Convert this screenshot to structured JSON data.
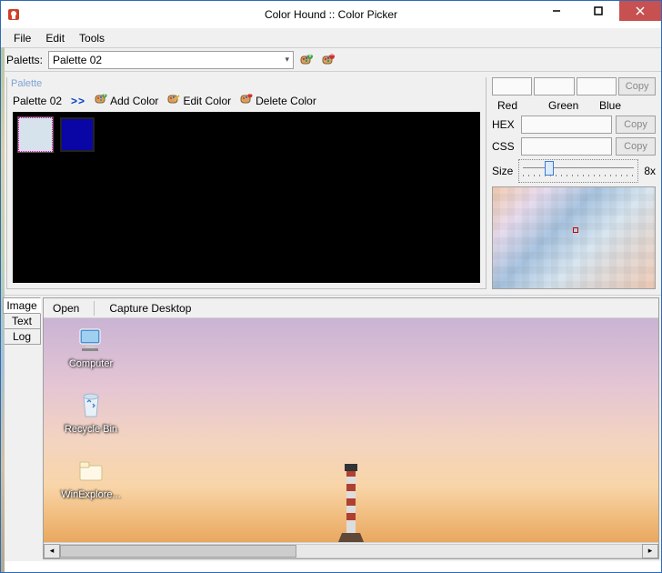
{
  "window": {
    "title": "Color Hound :: Color Picker"
  },
  "menubar": {
    "file": "File",
    "edit": "Edit",
    "tools": "Tools"
  },
  "toolbar": {
    "palettes_label": "Paletts:",
    "selected_palette": "Palette 02"
  },
  "palette_group": {
    "caption": "Palette",
    "name": "Palette 02",
    "expand": ">>",
    "add_color": "Add Color",
    "edit_color": "Edit Color",
    "delete_color": "Delete Color",
    "swatches": [
      {
        "color": "#d6e2ec",
        "selected": true
      },
      {
        "color": "#0a06a6",
        "selected": false
      }
    ]
  },
  "color_info": {
    "red_label": "Red",
    "green_label": "Green",
    "blue_label": "Blue",
    "hex_label": "HEX",
    "css_label": "CSS",
    "copy": "Copy",
    "size_label": "Size",
    "zoom_value": "8x",
    "hex_value": "",
    "css_value": "",
    "red_value": "",
    "green_value": "",
    "blue_value": ""
  },
  "side_tabs": {
    "image": "Image",
    "text": "Text",
    "log": "Log"
  },
  "image_toolbar": {
    "open": "Open",
    "capture": "Capture Desktop"
  },
  "desktop_icons": {
    "computer": "Computer",
    "recycle": "Recycle Bin",
    "winexplore": "WinExplore..."
  }
}
